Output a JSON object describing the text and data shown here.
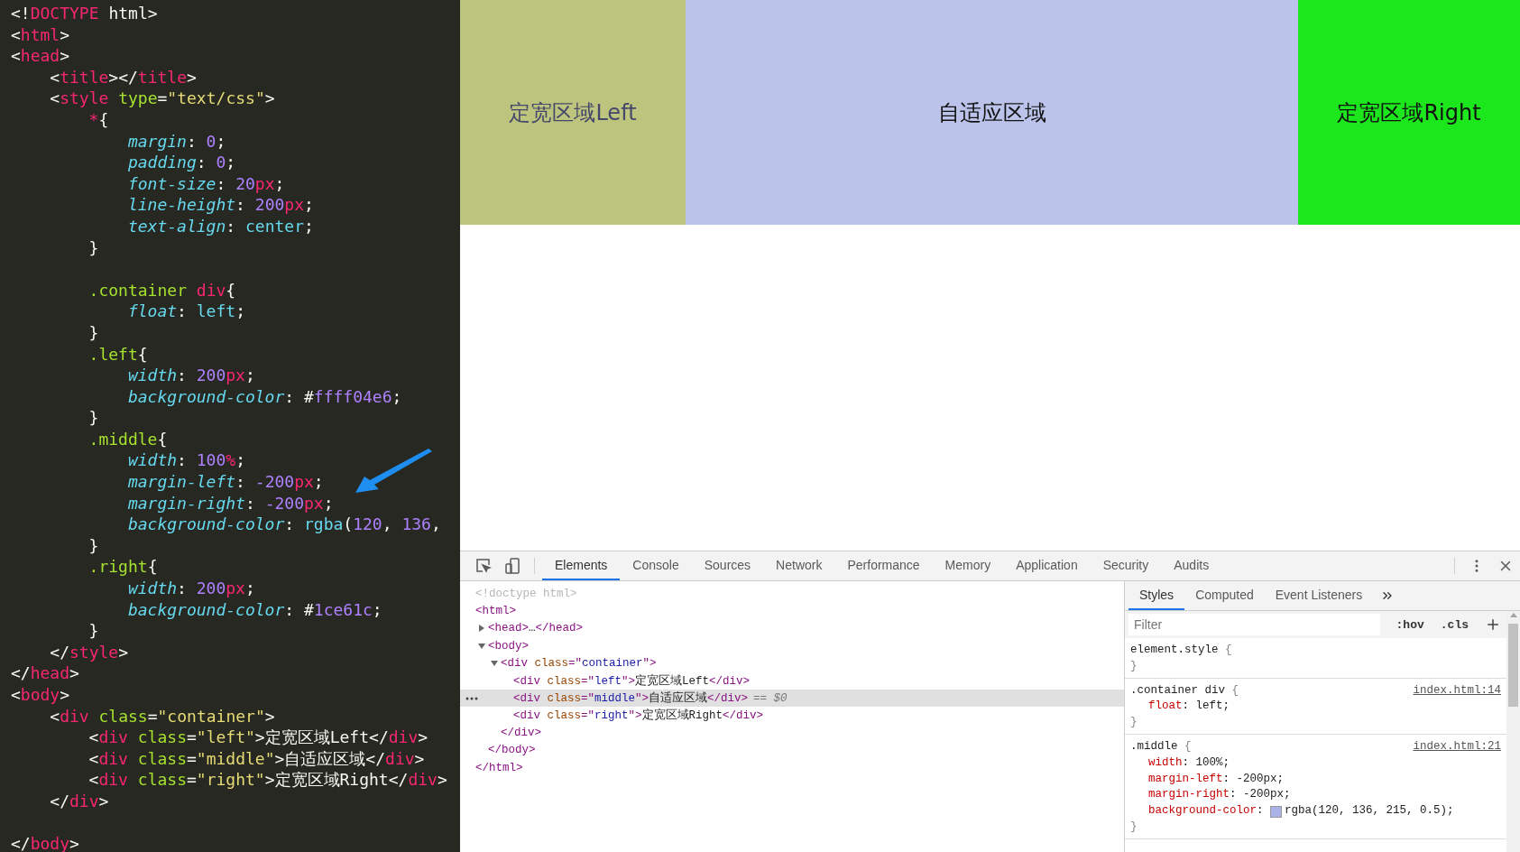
{
  "editor": {
    "lines": [
      {
        "kind": "code",
        "tokens": [
          {
            "t": "<!",
            "kind": "punct"
          },
          {
            "t": "DOCTYPE",
            "kind": "tag"
          },
          {
            "t": " html>",
            "kind": "punct"
          }
        ]
      },
      {
        "kind": "code",
        "tokens": [
          {
            "t": "<",
            "kind": "punct"
          },
          {
            "t": "html",
            "kind": "tag"
          },
          {
            "t": ">",
            "kind": "punct"
          }
        ]
      },
      {
        "kind": "code",
        "tokens": [
          {
            "t": "<",
            "kind": "punct"
          },
          {
            "t": "head",
            "kind": "tag"
          },
          {
            "t": ">",
            "kind": "punct"
          }
        ],
        "children": [
          {
            "kind": "code",
            "tokens": [
              {
                "t": "<",
                "kind": "punct"
              },
              {
                "t": "title",
                "kind": "tag"
              },
              {
                "t": "></",
                "kind": "punct"
              },
              {
                "t": "title",
                "kind": "tag"
              },
              {
                "t": ">",
                "kind": "punct"
              }
            ]
          },
          {
            "kind": "code",
            "tokens": [
              {
                "t": "<",
                "kind": "punct"
              },
              {
                "t": "style",
                "kind": "tag"
              },
              {
                "t": " type",
                "kind": "attr"
              },
              {
                "t": "=",
                "kind": "punct"
              },
              {
                "t": "\"text/css\"",
                "kind": "string"
              },
              {
                "t": ">",
                "kind": "punct"
              }
            ],
            "children": [
              {
                "kind": "code",
                "tokens": [
                  {
                    "t": "*",
                    "kind": "tag"
                  },
                  {
                    "t": "{",
                    "kind": "punct"
                  }
                ],
                "children": [
                  {
                    "kind": "code",
                    "tokens": [
                      {
                        "t": "margin",
                        "kind": "prop"
                      },
                      {
                        "t": ": ",
                        "kind": "punct"
                      },
                      {
                        "t": "0",
                        "kind": "number"
                      },
                      {
                        "t": ";",
                        "kind": "punct"
                      }
                    ]
                  },
                  {
                    "kind": "code",
                    "tokens": [
                      {
                        "t": "padding",
                        "kind": "prop"
                      },
                      {
                        "t": ": ",
                        "kind": "punct"
                      },
                      {
                        "t": "0",
                        "kind": "number"
                      },
                      {
                        "t": ";",
                        "kind": "punct"
                      }
                    ]
                  },
                  {
                    "kind": "code",
                    "tokens": [
                      {
                        "t": "font-size",
                        "kind": "prop"
                      },
                      {
                        "t": ": ",
                        "kind": "punct"
                      },
                      {
                        "t": "20",
                        "kind": "number"
                      },
                      {
                        "t": "px",
                        "kind": "unit"
                      },
                      {
                        "t": ";",
                        "kind": "punct"
                      }
                    ]
                  },
                  {
                    "kind": "code",
                    "tokens": [
                      {
                        "t": "line-height",
                        "kind": "prop"
                      },
                      {
                        "t": ": ",
                        "kind": "punct"
                      },
                      {
                        "t": "200",
                        "kind": "number"
                      },
                      {
                        "t": "px",
                        "kind": "unit"
                      },
                      {
                        "t": ";",
                        "kind": "punct"
                      }
                    ]
                  },
                  {
                    "kind": "code",
                    "tokens": [
                      {
                        "t": "text-align",
                        "kind": "prop"
                      },
                      {
                        "t": ": ",
                        "kind": "punct"
                      },
                      {
                        "t": "center",
                        "kind": "value"
                      },
                      {
                        "t": ";",
                        "kind": "punct"
                      }
                    ]
                  }
                ]
              },
              {
                "kind": "code",
                "tokens": [
                  {
                    "t": "}",
                    "kind": "punct"
                  }
                ]
              },
              {
                "kind": "blank"
              },
              {
                "kind": "code",
                "tokens": [
                  {
                    "t": ".container",
                    "kind": "attr"
                  },
                  {
                    "t": " div",
                    "kind": "tag"
                  },
                  {
                    "t": "{",
                    "kind": "punct"
                  }
                ],
                "children": [
                  {
                    "kind": "code",
                    "tokens": [
                      {
                        "t": "float",
                        "kind": "prop"
                      },
                      {
                        "t": ": ",
                        "kind": "punct"
                      },
                      {
                        "t": "left",
                        "kind": "value"
                      },
                      {
                        "t": ";",
                        "kind": "punct"
                      }
                    ]
                  }
                ]
              },
              {
                "kind": "code",
                "tokens": [
                  {
                    "t": "}",
                    "kind": "punct"
                  }
                ]
              },
              {
                "kind": "code",
                "tokens": [
                  {
                    "t": ".left",
                    "kind": "attr"
                  },
                  {
                    "t": "{",
                    "kind": "punct"
                  }
                ],
                "children": [
                  {
                    "kind": "code",
                    "tokens": [
                      {
                        "t": "width",
                        "kind": "prop"
                      },
                      {
                        "t": ": ",
                        "kind": "punct"
                      },
                      {
                        "t": "200",
                        "kind": "number"
                      },
                      {
                        "t": "px",
                        "kind": "unit"
                      },
                      {
                        "t": ";",
                        "kind": "punct"
                      }
                    ]
                  },
                  {
                    "kind": "code",
                    "tokens": [
                      {
                        "t": "background-color",
                        "kind": "prop"
                      },
                      {
                        "t": ": #",
                        "kind": "punct"
                      },
                      {
                        "t": "ffff04e6",
                        "kind": "number"
                      },
                      {
                        "t": ";",
                        "kind": "punct"
                      }
                    ]
                  }
                ]
              },
              {
                "kind": "code",
                "tokens": [
                  {
                    "t": "}",
                    "kind": "punct"
                  }
                ]
              },
              {
                "kind": "code",
                "tokens": [
                  {
                    "t": ".middle",
                    "kind": "attr"
                  },
                  {
                    "t": "{",
                    "kind": "punct"
                  }
                ],
                "children": [
                  {
                    "kind": "code",
                    "tokens": [
                      {
                        "t": "width",
                        "kind": "prop"
                      },
                      {
                        "t": ": ",
                        "kind": "punct"
                      },
                      {
                        "t": "100",
                        "kind": "number"
                      },
                      {
                        "t": "%",
                        "kind": "unit"
                      },
                      {
                        "t": ";",
                        "kind": "punct"
                      }
                    ]
                  },
                  {
                    "kind": "code",
                    "tokens": [
                      {
                        "t": "margin-left",
                        "kind": "prop"
                      },
                      {
                        "t": ": ",
                        "kind": "punct"
                      },
                      {
                        "t": "-200",
                        "kind": "number"
                      },
                      {
                        "t": "px",
                        "kind": "unit"
                      },
                      {
                        "t": ";",
                        "kind": "punct"
                      }
                    ]
                  },
                  {
                    "kind": "code",
                    "tokens": [
                      {
                        "t": "margin-right",
                        "kind": "prop"
                      },
                      {
                        "t": ": ",
                        "kind": "punct"
                      },
                      {
                        "t": "-200",
                        "kind": "number"
                      },
                      {
                        "t": "px",
                        "kind": "unit"
                      },
                      {
                        "t": ";",
                        "kind": "punct"
                      }
                    ]
                  },
                  {
                    "kind": "code",
                    "tokens": [
                      {
                        "t": "background-color",
                        "kind": "prop"
                      },
                      {
                        "t": ": ",
                        "kind": "punct"
                      },
                      {
                        "t": "rgba",
                        "kind": "value"
                      },
                      {
                        "t": "(",
                        "kind": "punct"
                      },
                      {
                        "t": "120",
                        "kind": "number"
                      },
                      {
                        "t": ", ",
                        "kind": "punct"
                      },
                      {
                        "t": "136",
                        "kind": "number"
                      },
                      {
                        "t": ",",
                        "kind": "punct"
                      }
                    ]
                  }
                ]
              },
              {
                "kind": "code",
                "tokens": [
                  {
                    "t": "}",
                    "kind": "punct"
                  }
                ]
              },
              {
                "kind": "code",
                "tokens": [
                  {
                    "t": ".right",
                    "kind": "attr"
                  },
                  {
                    "t": "{",
                    "kind": "punct"
                  }
                ],
                "children": [
                  {
                    "kind": "code",
                    "tokens": [
                      {
                        "t": "width",
                        "kind": "prop"
                      },
                      {
                        "t": ": ",
                        "kind": "punct"
                      },
                      {
                        "t": "200",
                        "kind": "number"
                      },
                      {
                        "t": "px",
                        "kind": "unit"
                      },
                      {
                        "t": ";",
                        "kind": "punct"
                      }
                    ]
                  },
                  {
                    "kind": "code",
                    "tokens": [
                      {
                        "t": "background-color",
                        "kind": "prop"
                      },
                      {
                        "t": ": #",
                        "kind": "punct"
                      },
                      {
                        "t": "1ce61c",
                        "kind": "number"
                      },
                      {
                        "t": ";",
                        "kind": "punct"
                      }
                    ]
                  }
                ]
              },
              {
                "kind": "code",
                "tokens": [
                  {
                    "t": "}",
                    "kind": "punct"
                  }
                ]
              }
            ]
          },
          {
            "kind": "code",
            "tokens": [
              {
                "t": "</",
                "kind": "punct"
              },
              {
                "t": "style",
                "kind": "tag"
              },
              {
                "t": ">",
                "kind": "punct"
              }
            ]
          }
        ]
      },
      {
        "kind": "code",
        "tokens": [
          {
            "t": "</",
            "kind": "punct"
          },
          {
            "t": "head",
            "kind": "tag"
          },
          {
            "t": ">",
            "kind": "punct"
          }
        ]
      },
      {
        "kind": "code",
        "tokens": [
          {
            "t": "<",
            "kind": "punct"
          },
          {
            "t": "body",
            "kind": "tag"
          },
          {
            "t": ">",
            "kind": "punct"
          }
        ],
        "children": [
          {
            "kind": "code",
            "tokens": [
              {
                "t": "<",
                "kind": "punct"
              },
              {
                "t": "div",
                "kind": "tag"
              },
              {
                "t": " class",
                "kind": "attr"
              },
              {
                "t": "=",
                "kind": "punct"
              },
              {
                "t": "\"container\"",
                "kind": "string"
              },
              {
                "t": ">",
                "kind": "punct"
              }
            ],
            "children": [
              {
                "kind": "code",
                "tokens": [
                  {
                    "t": "<",
                    "kind": "punct"
                  },
                  {
                    "t": "div",
                    "kind": "tag"
                  },
                  {
                    "t": " class",
                    "kind": "attr"
                  },
                  {
                    "t": "=",
                    "kind": "punct"
                  },
                  {
                    "t": "\"left\"",
                    "kind": "string"
                  },
                  {
                    "t": ">定宽区域Left</",
                    "kind": "punct"
                  },
                  {
                    "t": "div",
                    "kind": "tag"
                  },
                  {
                    "t": ">",
                    "kind": "punct"
                  }
                ]
              },
              {
                "kind": "code",
                "tokens": [
                  {
                    "t": "<",
                    "kind": "punct"
                  },
                  {
                    "t": "div",
                    "kind": "tag"
                  },
                  {
                    "t": " class",
                    "kind": "attr"
                  },
                  {
                    "t": "=",
                    "kind": "punct"
                  },
                  {
                    "t": "\"middle\"",
                    "kind": "string"
                  },
                  {
                    "t": ">自适应区域</",
                    "kind": "punct"
                  },
                  {
                    "t": "div",
                    "kind": "tag"
                  },
                  {
                    "t": ">",
                    "kind": "punct"
                  }
                ]
              },
              {
                "kind": "code",
                "tokens": [
                  {
                    "t": "<",
                    "kind": "punct"
                  },
                  {
                    "t": "div",
                    "kind": "tag"
                  },
                  {
                    "t": " class",
                    "kind": "attr"
                  },
                  {
                    "t": "=",
                    "kind": "punct"
                  },
                  {
                    "t": "\"right\"",
                    "kind": "string"
                  },
                  {
                    "t": ">定宽区域Right</",
                    "kind": "punct"
                  },
                  {
                    "t": "div",
                    "kind": "tag"
                  },
                  {
                    "t": ">",
                    "kind": "punct"
                  }
                ]
              }
            ]
          },
          {
            "kind": "code",
            "tokens": [
              {
                "t": "</",
                "kind": "punct"
              },
              {
                "t": "div",
                "kind": "tag"
              },
              {
                "t": ">",
                "kind": "punct"
              }
            ]
          },
          {
            "kind": "blank"
          }
        ]
      },
      {
        "kind": "code",
        "tokens": [
          {
            "t": "</",
            "kind": "punct"
          },
          {
            "t": "body",
            "kind": "tag"
          },
          {
            "t": ">",
            "kind": "punct"
          }
        ]
      }
    ]
  },
  "preview": {
    "blocks": [
      {
        "text": "定宽区域Left",
        "color": "#bdc47e"
      },
      {
        "text": "自适应区域",
        "color": "#bbc3ea"
      },
      {
        "text": "定宽区域Right",
        "color": "#1ce61c"
      }
    ]
  },
  "devtools": {
    "tabs": [
      {
        "label": "Elements",
        "selected": true
      },
      {
        "label": "Console",
        "selected": false
      },
      {
        "label": "Sources",
        "selected": false
      },
      {
        "label": "Network",
        "selected": false
      },
      {
        "label": "Performance",
        "selected": false
      },
      {
        "label": "Memory",
        "selected": false
      },
      {
        "label": "Application",
        "selected": false
      },
      {
        "label": "Security",
        "selected": false
      },
      {
        "label": "Audits",
        "selected": false
      }
    ],
    "dom_tree": [
      {
        "line": [
          {
            "t": "<!doctype html>",
            "kind": "doctype"
          }
        ],
        "selected": false
      },
      {
        "line": [
          {
            "t": "<html>",
            "kind": "tag"
          }
        ],
        "close": [
          {
            "t": "</html>",
            "kind": "tag"
          }
        ],
        "selected": false,
        "children": [
          {
            "line": [
              {
                "t": "<head>",
                "kind": "tag"
              },
              {
                "t": "…",
                "kind": "text"
              },
              {
                "t": "</head>",
                "kind": "tag"
              }
            ],
            "expanded": false,
            "selected": false
          },
          {
            "line": [
              {
                "t": "<body>",
                "kind": "tag"
              }
            ],
            "close": [
              {
                "t": "</body>",
                "kind": "tag"
              }
            ],
            "expanded": true,
            "selected": false,
            "children": [
              {
                "line": [
                  {
                    "t": "<div",
                    "kind": "tag"
                  },
                  {
                    "t": " class",
                    "kind": "attr"
                  },
                  {
                    "t": "=\"",
                    "kind": "tag"
                  },
                  {
                    "t": "container",
                    "kind": "value"
                  },
                  {
                    "t": "\">",
                    "kind": "tag"
                  }
                ],
                "close": [
                  {
                    "t": "</div>",
                    "kind": "tag"
                  }
                ],
                "expanded": true,
                "selected": false,
                "children": [
                  {
                    "line": [
                      {
                        "t": "<div",
                        "kind": "tag"
                      },
                      {
                        "t": " class",
                        "kind": "attr"
                      },
                      {
                        "t": "=\"",
                        "kind": "tag"
                      },
                      {
                        "t": "left",
                        "kind": "value"
                      },
                      {
                        "t": "\">",
                        "kind": "tag"
                      },
                      {
                        "t": "定宽区域Left",
                        "kind": "text"
                      },
                      {
                        "t": "</div>",
                        "kind": "tag"
                      }
                    ],
                    "selected": false
                  },
                  {
                    "line": [
                      {
                        "t": "<div",
                        "kind": "tag"
                      },
                      {
                        "t": " class",
                        "kind": "attr"
                      },
                      {
                        "t": "=\"",
                        "kind": "tag"
                      },
                      {
                        "t": "middle",
                        "kind": "value"
                      },
                      {
                        "t": "\">",
                        "kind": "tag"
                      },
                      {
                        "t": "自适应区域",
                        "kind": "text"
                      },
                      {
                        "t": "</div>",
                        "kind": "tag"
                      }
                    ],
                    "note": "== $0",
                    "selected": true
                  },
                  {
                    "line": [
                      {
                        "t": "<div",
                        "kind": "tag"
                      },
                      {
                        "t": " class",
                        "kind": "attr"
                      },
                      {
                        "t": "=\"",
                        "kind": "tag"
                      },
                      {
                        "t": "right",
                        "kind": "value"
                      },
                      {
                        "t": "\">",
                        "kind": "tag"
                      },
                      {
                        "t": "定宽区域Right",
                        "kind": "text"
                      },
                      {
                        "t": "</div>",
                        "kind": "tag"
                      }
                    ],
                    "selected": false
                  }
                ]
              }
            ]
          }
        ]
      }
    ],
    "styles_panel": {
      "tabs": [
        {
          "label": "Styles",
          "selected": true
        },
        {
          "label": "Computed",
          "selected": false
        },
        {
          "label": "Event Listeners",
          "selected": false
        }
      ],
      "filter": {
        "placeholder": "Filter"
      },
      "toggles": [
        ":hov",
        ".cls"
      ],
      "rules": [
        {
          "selector": "element.style",
          "brace_open": "{",
          "brace_close": "}"
        },
        {
          "selector": ".container div",
          "brace_open": "{",
          "brace_close": "}",
          "source": "index.html:14",
          "declarations": [
            {
              "name": "float",
              "colon": ":",
              "value": "left;"
            }
          ]
        },
        {
          "selector": ".middle",
          "brace_open": "{",
          "brace_close": "}",
          "source": "index.html:21",
          "declarations": [
            {
              "name": "width",
              "colon": ":",
              "value": "100%;"
            },
            {
              "name": "margin-left",
              "colon": ":",
              "value": "-200px;"
            },
            {
              "name": "margin-right",
              "colon": ":",
              "value": "-200px;"
            },
            {
              "name": "background-color",
              "colon": ":",
              "value": "rgba(120, 136, 215, 0.5);",
              "color": "#aab2e6"
            }
          ]
        }
      ]
    }
  }
}
